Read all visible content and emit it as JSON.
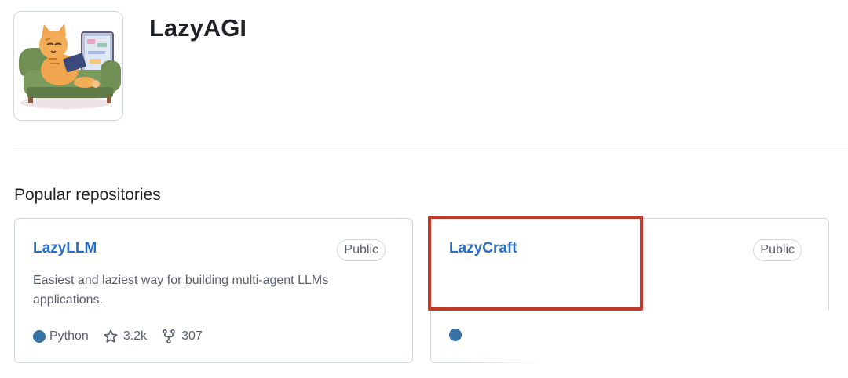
{
  "org": {
    "name": "LazyAGI",
    "avatar_icon": "cat-on-couch-avatar"
  },
  "popular": {
    "title": "Popular repositories",
    "repos": [
      {
        "name": "LazyLLM",
        "visibility": "Public",
        "description": "Easiest and laziest way for building multi-agent LLMs applications.",
        "language": "Python",
        "language_color": "#3572A5",
        "stars": "3.2k",
        "forks": "307"
      },
      {
        "name": "LazyCraft",
        "visibility": "Public",
        "language_color": "#3572A5"
      }
    ]
  },
  "colors": {
    "link": "#2a6ec9",
    "highlight": "#c0392b",
    "border": "#d0d7de"
  }
}
